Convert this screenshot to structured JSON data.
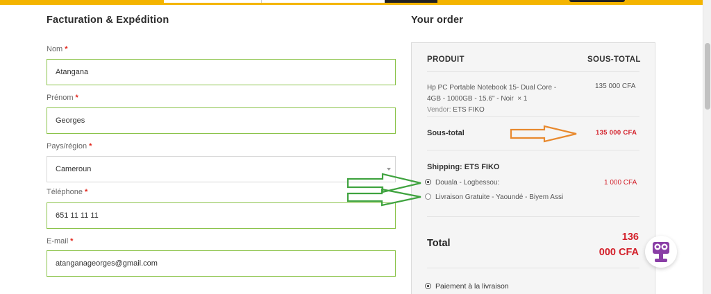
{
  "billing": {
    "title": "Facturation & Expédition",
    "fields": [
      {
        "label": "Nom",
        "value": "Atangana"
      },
      {
        "label": "Prénom",
        "value": "Georges"
      },
      {
        "label": "Pays/région",
        "value": "Cameroun"
      },
      {
        "label": "Téléphone",
        "value": "651 11 11 11"
      },
      {
        "label": "E-mail",
        "value": "atanganageorges@gmail.com"
      }
    ],
    "required_mark": "*"
  },
  "order": {
    "title": "Your order",
    "col_product": "PRODUIT",
    "col_subtotal": "SOUS-TOTAL",
    "item": {
      "name_line1": "Hp PC Portable Notebook 15- Dual Core -",
      "name_line2": "4GB - 1000GB - 15.6\" - Noir",
      "qty": "× 1",
      "vendor_label": "Vendor:",
      "vendor": "ETS FIKO",
      "price": "135 000 CFA"
    },
    "subtotal_label": "Sous-total",
    "subtotal_value": "135 000 CFA",
    "shipping_title": "Shipping: ETS FIKO",
    "shipping_options": [
      {
        "label": "Douala - Logbessou:",
        "price": "1 000 CFA",
        "selected": true
      },
      {
        "label": "Livraison Gratuite - Yaoundé - Biyem Assi",
        "price": "",
        "selected": false
      }
    ],
    "total_label": "Total",
    "total_value_line1": "136",
    "total_value_line2": "000 CFA",
    "payment_option": "Paiement à la livraison"
  },
  "annotations": {
    "orange_arrow_color": "#e8892e",
    "green_arrow_color": "#3fa33f"
  },
  "chat": {
    "icon": "chat-robot-icon",
    "color": "#8a3ea6"
  },
  "colors": {
    "accent_yellow": "#f4b400",
    "price_red": "#d3202a",
    "field_border": "#8bc34a"
  }
}
